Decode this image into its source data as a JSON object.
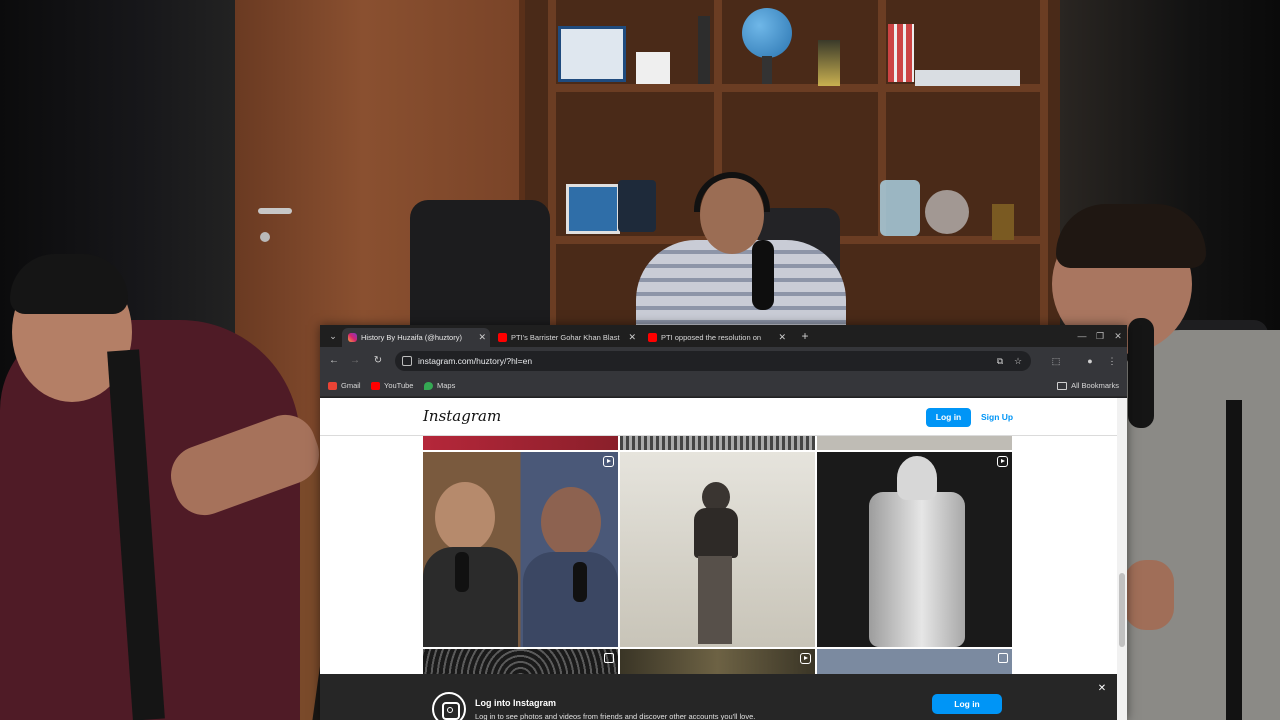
{
  "browser": {
    "tabs": [
      {
        "title": "History By Huzaifa (@huztory)",
        "favicon": "instagram-favicon",
        "active": true
      },
      {
        "title": "PTI's Barrister Gohar Khan Blast",
        "favicon": "youtube-favicon",
        "active": false
      },
      {
        "title": "PTI opposed the resolution on",
        "favicon": "youtube-favicon",
        "active": false
      }
    ],
    "new_tab": "+",
    "url": "instagram.com/huztory/?hl=en",
    "bookmarks": [
      {
        "label": "Gmail",
        "icon": "gmail-icon"
      },
      {
        "label": "YouTube",
        "icon": "youtube-icon"
      },
      {
        "label": "Maps",
        "icon": "maps-icon"
      }
    ],
    "all_bookmarks": "All Bookmarks"
  },
  "instagram": {
    "logo": "Instagram",
    "login": "Log in",
    "signup": "Sign Up",
    "banner": {
      "title": "Log into Instagram",
      "subtitle": "Log in to see photos and videos from friends and discover other accounts you'll love.",
      "login": "Log in"
    },
    "posts": [
      {
        "desc": "podcast clip",
        "icon": "reel-icon"
      },
      {
        "desc": "vintage photo of man",
        "icon": ""
      },
      {
        "desc": "ancient clay jar",
        "icon": "reel-icon"
      },
      {
        "desc": "ornate pattern",
        "icon": "multi-icon"
      },
      {
        "desc": "old map",
        "icon": "reel-icon"
      },
      {
        "desc": "travel typography",
        "icon": "multi-icon"
      }
    ]
  },
  "colors": {
    "instagram_blue": "#0095f6",
    "chrome_dark": "#35363a",
    "banner_dark": "#262626"
  }
}
